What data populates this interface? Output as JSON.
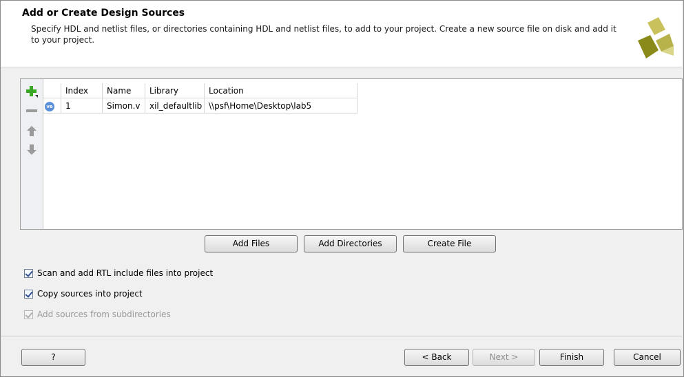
{
  "header": {
    "title": "Add or Create Design Sources",
    "description": "Specify HDL and netlist files, or directories containing HDL and netlist files, to add to your project. Create a new source file on disk and add it to your project."
  },
  "table": {
    "columns": [
      "",
      "Index",
      "Name",
      "Library",
      "Location"
    ],
    "rows": [
      {
        "type_badge": "ve",
        "index": "1",
        "name": "Simon.v",
        "library": "xil_defaultlib",
        "location": "\\\\psf\\Home\\Desktop\\lab5"
      }
    ]
  },
  "side_toolbar": {
    "icons": [
      "add-icon",
      "remove-icon",
      "move-up-icon",
      "move-down-icon"
    ],
    "colors": {
      "add": "#3aa626",
      "disabled": "#9a9a9a"
    }
  },
  "actions": {
    "add_files": "Add Files",
    "add_directories": "Add Directories",
    "create_file": "Create File"
  },
  "options": {
    "scan_rtl": {
      "label": "Scan and add RTL include files into project",
      "checked": true,
      "enabled": true
    },
    "copy_sources": {
      "label": "Copy sources into project",
      "checked": true,
      "enabled": true
    },
    "add_subdirs": {
      "label": "Add sources from subdirectories",
      "checked": true,
      "enabled": false
    }
  },
  "footer": {
    "help": "?",
    "back": "< Back",
    "next": "Next >",
    "finish": "Finish",
    "cancel": "Cancel"
  }
}
